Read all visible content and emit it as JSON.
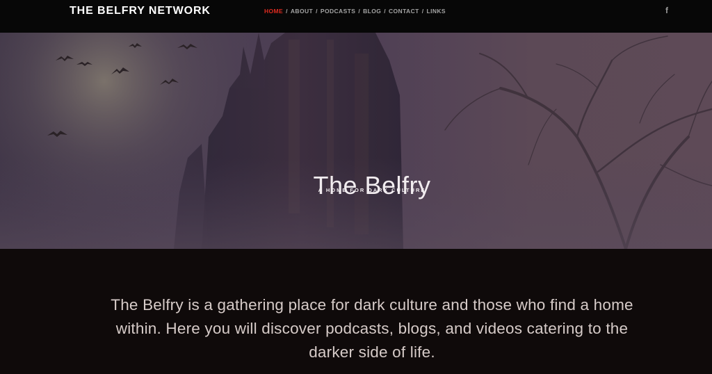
{
  "header": {
    "brand": "THE BELFRY NETWORK",
    "nav": [
      {
        "label": "HOME",
        "active": true
      },
      {
        "label": "ABOUT"
      },
      {
        "label": "PODCASTS"
      },
      {
        "label": "BLOG"
      },
      {
        "label": "CONTACT"
      },
      {
        "label": "LINKS"
      }
    ],
    "nav_separator": "/",
    "social_icon": "f"
  },
  "hero": {
    "title": "The Belfry",
    "subtitle": "A HOME FOR DARK CULTURE"
  },
  "intro": {
    "text": "The Belfry is a gathering place for dark culture and those who find a home within. Here you will discover podcasts, blogs, and videos catering to the darker side of life."
  },
  "colors": {
    "header_bg": "#070707",
    "active_nav": "#e02b20",
    "nav_text": "#a4a4a4",
    "body_bg": "#0f0a0a",
    "body_text": "#d6cbc8"
  }
}
